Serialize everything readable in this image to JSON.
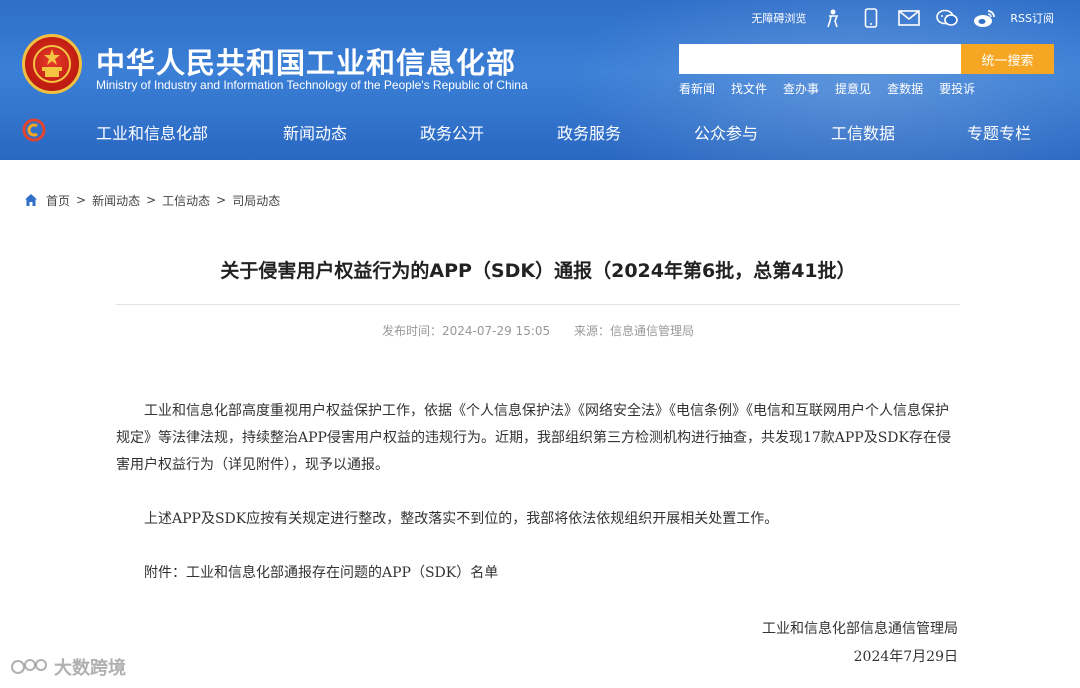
{
  "header": {
    "title": "中华人民共和国工业和信息化部",
    "subtitle": "Ministry of Industry and Information Technology of the People's Republic of China",
    "top_links": {
      "accessibility": "无障碍浏览",
      "rss": "RSS订阅"
    },
    "search": {
      "placeholder": "",
      "button_label": "统一搜索"
    },
    "quick_links": [
      "看新闻",
      "找文件",
      "查办事",
      "提意见",
      "查数据",
      "要投诉"
    ],
    "nav": [
      "工业和信息化部",
      "新闻动态",
      "政务公开",
      "政务服务",
      "公众参与",
      "工信数据",
      "专题专栏"
    ],
    "colors": {
      "banner": "#2f6fc9",
      "search_button": "#f5a623"
    }
  },
  "breadcrumb": [
    "首页",
    "新闻动态",
    "工信动态",
    "司局动态"
  ],
  "article": {
    "title": "关于侵害用户权益行为的APP（SDK）通报（2024年第6批，总第41批）",
    "publish_time": "发布时间：2024-07-29 15:05",
    "source": "来源：信息通信管理局",
    "paragraphs": [
      "工业和信息化部高度重视用户权益保护工作，依据《个人信息保护法》《网络安全法》《电信条例》《电信和互联网用户个人信息保护规定》等法律法规，持续整治APP侵害用户权益的违规行为。近期，我部组织第三方检测机构进行抽查，共发现17款APP及SDK存在侵害用户权益行为（详见附件），现予以通报。",
      "上述APP及SDK应按有关规定进行整改，整改落实不到位的，我部将依法依规组织开展相关处置工作。",
      "附件：工业和信息化部通报存在问题的APP（SDK）名单"
    ],
    "signature": "工业和信息化部信息通信管理局",
    "date": "2024年7月29日"
  },
  "watermark": "大数跨境"
}
